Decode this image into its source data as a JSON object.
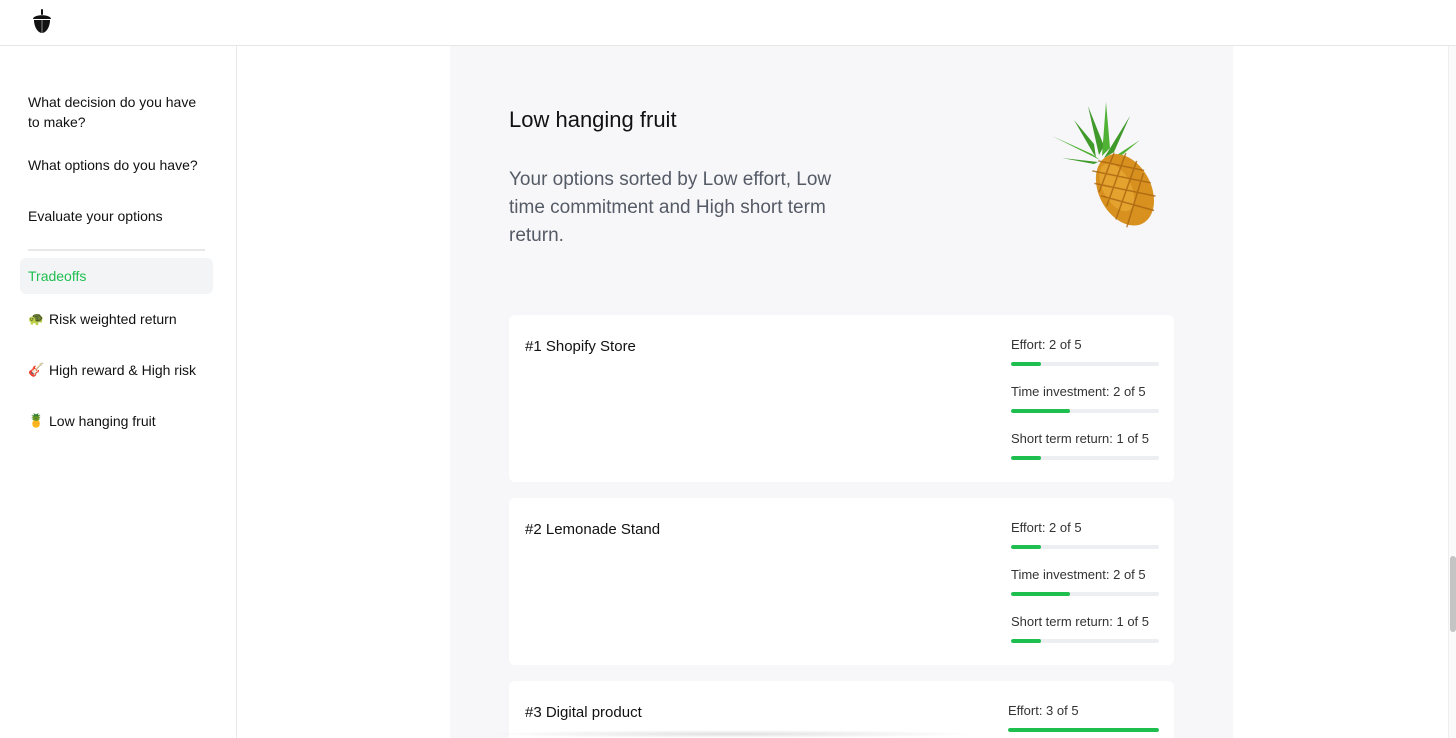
{
  "header": {
    "logo_icon": "acorn-icon"
  },
  "sidebar": {
    "items": [
      {
        "label": "What decision do you have to make?"
      },
      {
        "label": "What options do you have?"
      },
      {
        "label": "Evaluate your options"
      }
    ],
    "section_label": "Tradeoffs",
    "sub_items": [
      {
        "emoji": "🐢",
        "label": "Risk weighted return"
      },
      {
        "emoji": "🎸",
        "label": "High reward & High risk"
      },
      {
        "emoji": "🍍",
        "label": "Low hanging fruit"
      }
    ]
  },
  "main": {
    "title": "Low hanging fruit",
    "subtitle": "Your options sorted by Low effort, Low time commitment and High short term return.",
    "illustration": "pineapple-icon",
    "accent_color": "#1fbf4f",
    "cards": [
      {
        "title": "#1 Shopify Store",
        "metrics": [
          {
            "label": "Effort: 2 of 5",
            "fraction": 0.2
          },
          {
            "label": "Time investment: 2 of 5",
            "fraction": 0.4
          },
          {
            "label": "Short term return: 1 of 5",
            "fraction": 0.2
          }
        ]
      },
      {
        "title": "#2 Lemonade Stand",
        "metrics": [
          {
            "label": "Effort: 2 of 5",
            "fraction": 0.2
          },
          {
            "label": "Time investment: 2 of 5",
            "fraction": 0.4
          },
          {
            "label": "Short term return: 1 of 5",
            "fraction": 0.2
          }
        ]
      },
      {
        "title": "#3 Digital product",
        "metrics": [
          {
            "label": "Effort: 3 of 5",
            "fraction": 1.0
          }
        ]
      }
    ]
  }
}
